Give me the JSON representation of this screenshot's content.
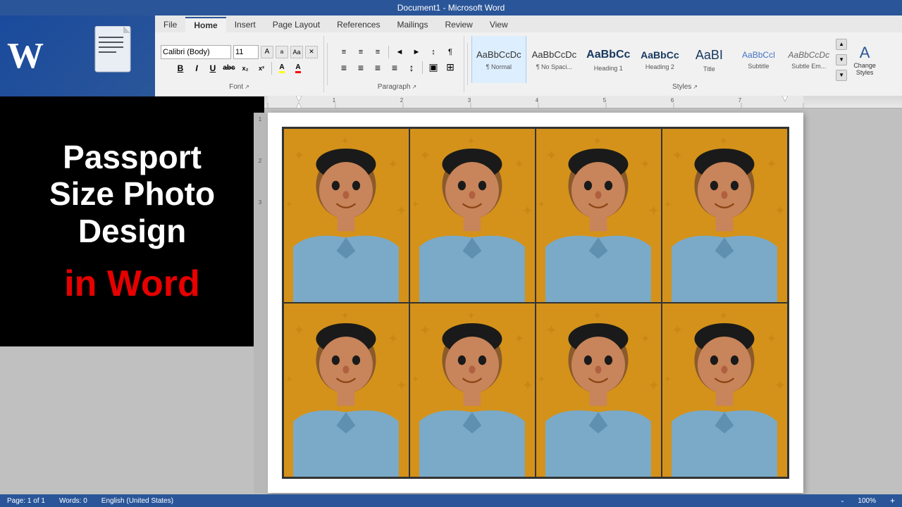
{
  "titleBar": {
    "title": "Document1 - Microsoft Word"
  },
  "ribbon": {
    "tabs": [
      "File",
      "Home",
      "Insert",
      "Page Layout",
      "References",
      "Mailings",
      "Review",
      "View"
    ],
    "activeTab": "Home",
    "fontGroup": {
      "label": "Font",
      "font": "Calibri",
      "size": "11",
      "growBtn": "A",
      "shrinkBtn": "a",
      "caseBtn": "Aa",
      "clearBtn": "✕",
      "boldBtn": "B",
      "italicBtn": "I",
      "underlineBtn": "U",
      "strikeBtn": "abc",
      "subscriptBtn": "x₂",
      "superscriptBtn": "x²",
      "highlightBtn": "A",
      "colorBtn": "A"
    },
    "paragraphGroup": {
      "label": "Paragraph",
      "listBtn": "≡",
      "numberedListBtn": "≡",
      "indentDecBtn": "◄",
      "indentIncBtn": "►",
      "sortBtn": "↕",
      "showHideBtn": "¶",
      "alignLeftBtn": "≡",
      "alignCenterBtn": "≡",
      "alignRightBtn": "≡",
      "justifyBtn": "≡",
      "lineSpacingBtn": "↕",
      "shadingBtn": "▣",
      "bordersBtn": "⊞"
    },
    "stylesGroup": {
      "label": "Styles",
      "styles": [
        {
          "preview": "AaBbCcDc",
          "name": "¶ Normal",
          "class": "normal",
          "active": true
        },
        {
          "preview": "AaBbCcDc",
          "name": "¶ No Spaci...",
          "class": "normal",
          "active": false
        },
        {
          "preview": "AaBbCc",
          "name": "Heading 1",
          "class": "heading1",
          "active": false
        },
        {
          "preview": "AaBbCc",
          "name": "Heading 2",
          "class": "heading2",
          "active": false
        },
        {
          "preview": "AaBI",
          "name": "Title",
          "class": "title-style",
          "active": false
        },
        {
          "preview": "AaBbCcl",
          "name": "Subtitle",
          "class": "subtitle",
          "active": false
        },
        {
          "preview": "AaBbCcDc",
          "name": "Subtle Em...",
          "class": "subtle",
          "active": false
        }
      ],
      "changeStylesLabel": "Change\nStyles"
    }
  },
  "titlePanel": {
    "mainText": "Passport\nSize Photo\nDesign",
    "redText": "in Word"
  },
  "statusBar": {
    "page": "Page: 1 of 1",
    "words": "Words: 0",
    "language": "English (United States)"
  },
  "ruler": {
    "markers": [
      "1",
      "2",
      "3",
      "4",
      "5"
    ]
  }
}
